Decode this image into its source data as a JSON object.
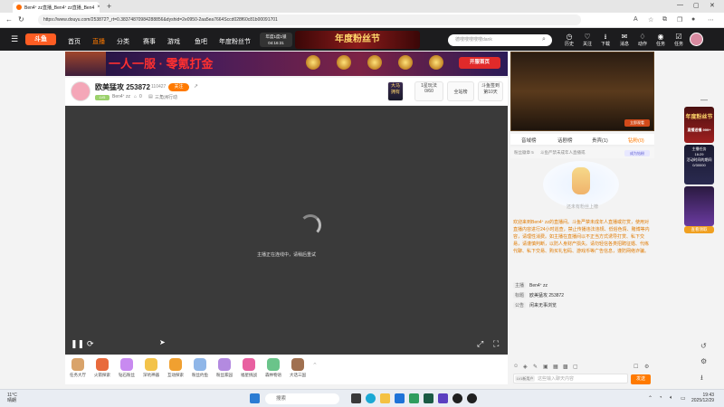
{
  "browser": {
    "tab_title": "Ben4ᐩ zz直播_Ben4ᐩ zz直播_Ben4",
    "url": "https://www.douyu.com/253872?_rt=0.38374870984288856&dyshid=2e0950-2aa5ea7664Sccd028f60c81b00091701"
  },
  "site_header": {
    "logo": "斗鱼",
    "nav": [
      "首页",
      "直播",
      "分类",
      "赛事",
      "游戏",
      "鱼吧",
      "年度粉丝节"
    ],
    "promo_badge_line1": "年度1度1锁",
    "promo_badge_line2": "04:16:31",
    "promo_banner": "年度粉丝节",
    "promo_banner_tag": "斗鱼年度盛典",
    "search_placeholder": "德嗖嗖嗖嗖嗖dank",
    "icons": [
      "历史",
      "关注",
      "下载",
      "消息",
      "动作",
      "任务"
    ]
  },
  "ad_banner": {
    "text": "一人一服 · 零氪打金",
    "button": "开服首页",
    "gems": [
      "2W鱼丸",
      "500鱼翅",
      "鱼丸",
      "飞机",
      "火箭"
    ]
  },
  "room": {
    "title": "欧美猛攻 253872",
    "hot": "110427",
    "follow": "关注",
    "level": "LV5",
    "streamer": "Ben4ᐩ zz",
    "count": "0",
    "tag": "三角洲行动",
    "box1_line1": "大马",
    "box1_line2": "拥有",
    "box2_line1": "1星玩法",
    "box2_line2": "0/60",
    "box3": "全站榜",
    "box4_line1": "斗鱼签到",
    "box4_line2": "第10天"
  },
  "player": {
    "message": "主播正在连线中，请稍后重试"
  },
  "gifts": [
    "任务大厅",
    "火箭探索",
    "钻石粉丝",
    "深坑神器",
    "互动探索",
    "粉丝约鱼",
    "粉丝家园",
    "福星挑战",
    "森林物语",
    "大话三国"
  ],
  "right_panel": {
    "tabs": [
      "音域榜",
      "话剧榜",
      "贵宾(1)",
      "钻粉(0)"
    ],
    "fan_label": "粉丝徽章  5",
    "fan_notice": "斗鱼严禁未成年人直播或",
    "become_fan": "成为钻粉",
    "empty_text": "还未有粉丝上榜",
    "notice": "欢迎来到Ben4ᐩ zz的直播间。斗鱼严禁未成年人直播或打赏，使用对直播内容进行24小时巡查，禁止传播违法违规、低俗色情、赌博等内容，请理性消费。如主播在直播间以不正当方式诱导打赏、私下交易，请谨慎判断，以防人身财产损失。请勿轻信各类招聘征婚、代练代聊、私下交易、购买礼包码、游戏币等广告信息，谨防网络诈骗。",
    "info": [
      {
        "k": "主播",
        "v": "Ben4ᐩ zz"
      },
      {
        "k": "标题",
        "v": "欧美猛攻 253872"
      },
      {
        "k": "公告",
        "v": "闲来无事浏览"
      }
    ],
    "chat_level": "LV1新用户",
    "chat_placeholder": "这些输入聊天内容",
    "send": "发送",
    "thumb_button": "立即观看"
  },
  "side_ads": {
    "ad1_title": "年度粉丝节",
    "ad1_sub": "直播送福 999+",
    "ad2_sub": "主播任务",
    "ad2_time": "16:29",
    "ad2_text": "活动时间的期间",
    "ad2_progress": "0/30000",
    "ad3": "查看领取"
  },
  "taskbar": {
    "temp": "11°C",
    "weather": "晴朗",
    "search": "搜索",
    "time": "19:43",
    "date": "2025/12/29"
  }
}
